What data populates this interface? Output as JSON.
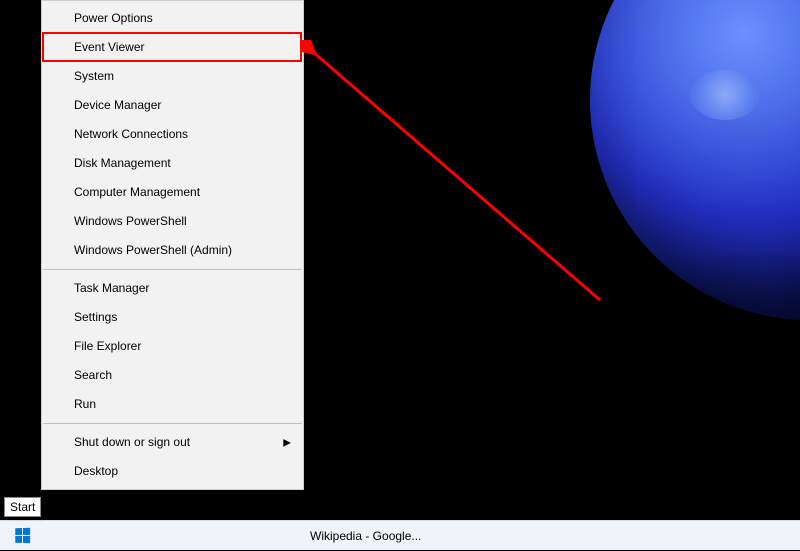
{
  "menu": {
    "group1": [
      "Power Options",
      "Event Viewer",
      "System",
      "Device Manager",
      "Network Connections",
      "Disk Management",
      "Computer Management",
      "Windows PowerShell",
      "Windows PowerShell (Admin)"
    ],
    "group2": [
      "Task Manager",
      "Settings",
      "File Explorer",
      "Search",
      "Run"
    ],
    "group3": [
      {
        "label": "Shut down or sign out",
        "submenu": true
      },
      {
        "label": "Desktop",
        "submenu": false
      }
    ]
  },
  "tooltip": {
    "start": "Start"
  },
  "taskbar": {
    "browser_title": "Wikipedia - Google..."
  },
  "annotation": {
    "highlight_index": 1,
    "arrow_color": "#ff0000"
  }
}
